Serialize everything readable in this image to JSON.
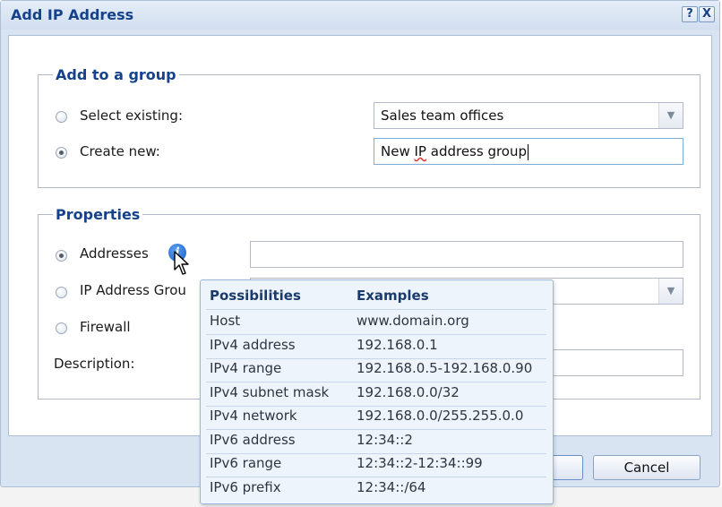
{
  "dialog": {
    "title": "Add IP Address",
    "help_label": "?",
    "close_label": "X"
  },
  "group_section": {
    "legend": "Add to a group",
    "select_existing_label": "Select existing:",
    "select_existing_checked": false,
    "existing_value": "Sales team offices",
    "create_new_label": "Create new:",
    "create_new_checked": true,
    "new_value_part1": "New ",
    "new_value_typo": "IP",
    "new_value_part2": " address group"
  },
  "properties_section": {
    "legend": "Properties",
    "addresses_label": "Addresses",
    "addresses_checked": true,
    "addresses_value": "",
    "ip_group_label": "IP Address Grou",
    "ip_group_checked": false,
    "firewall_label": "Firewall",
    "firewall_checked": false,
    "description_label": "Description:",
    "description_value": ""
  },
  "info_icon_glyph": "i",
  "tooltip": {
    "col1_header": "Possibilities",
    "col2_header": "Examples",
    "rows": [
      {
        "possibility": "Host",
        "example": "www.domain.org"
      },
      {
        "possibility": "IPv4 address",
        "example": "192.168.0.1"
      },
      {
        "possibility": "IPv4 range",
        "example": "192.168.0.5-192.168.0.90"
      },
      {
        "possibility": "IPv4 subnet mask",
        "example": "192.168.0.0/32"
      },
      {
        "possibility": "IPv4 network",
        "example": "192.168.0.0/255.255.0.0"
      },
      {
        "possibility": "IPv6 address",
        "example": "12:34::2"
      },
      {
        "possibility": "IPv6 range",
        "example": "12:34::2-12:34::99"
      },
      {
        "possibility": "IPv6 prefix",
        "example": "12:34::/64"
      }
    ]
  },
  "buttons": {
    "cancel_label": "Cancel"
  },
  "colors": {
    "title_text": "#15428b",
    "dialog_bg": "#d8e4f2",
    "tooltip_bg": "#eef4fc"
  }
}
